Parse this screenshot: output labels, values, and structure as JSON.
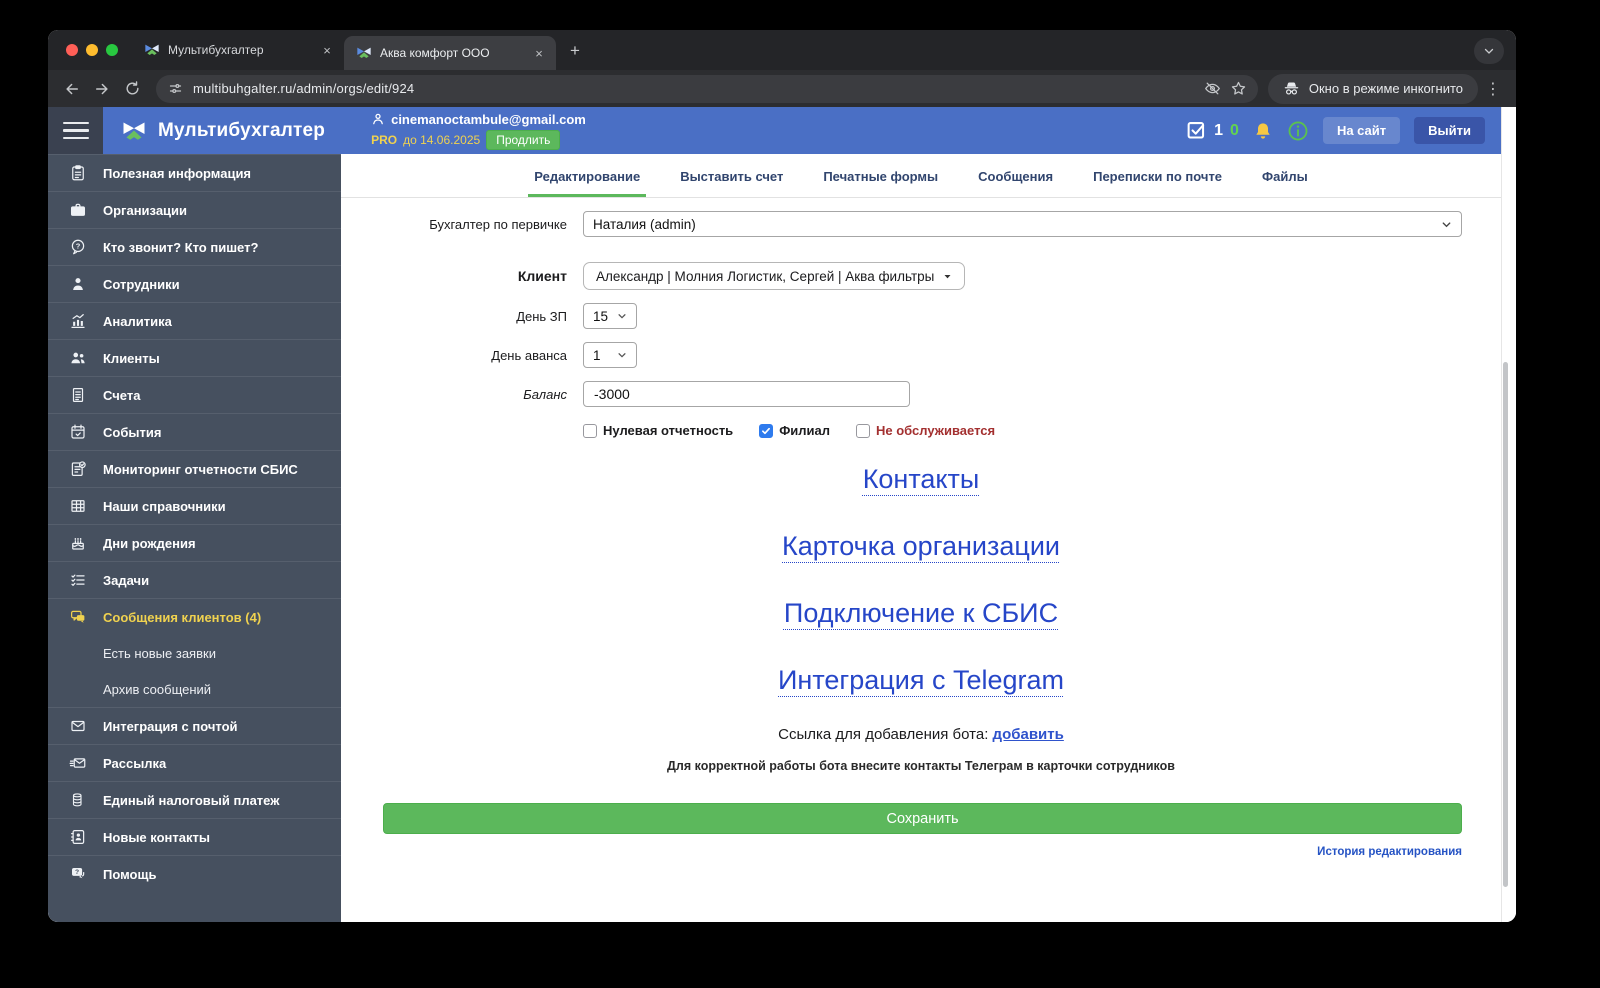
{
  "colors": {
    "header-blue": "#4a6fc5",
    "sidebar-dark": "#46505f",
    "sidebar-darker": "#3a4150",
    "accent-green": "#5cb85c",
    "accent-yellow": "#f0d24f",
    "link-blue": "#2646c8",
    "tab-navy": "#31456e",
    "danger-red": "#a33030",
    "checkbox-blue": "#2e7bee"
  },
  "browser": {
    "tab1_title": "Мультибухгалтер",
    "tab2_title": "Аква комфорт ООО",
    "url": "multibuhgalter.ru/admin/orgs/edit/924",
    "incognito_label": "Окно в режиме инкогнито"
  },
  "header": {
    "brand": "Мультибухгалтер",
    "email": "cinemanoctambule@gmail.com",
    "plan_badge": "PRO",
    "plan_until": "до 14.06.2025",
    "renew_button": "Продлить",
    "counter_primary": "1",
    "counter_secondary": "0",
    "site_button": "На сайт",
    "logout_button": "Выйти"
  },
  "sidebar": {
    "items": [
      {
        "label": "Полезная информация",
        "icon": "clipboard-icon"
      },
      {
        "label": "Организации",
        "icon": "briefcase-icon"
      },
      {
        "label": "Кто звонит? Кто пишет?",
        "icon": "question-bubble-icon"
      },
      {
        "label": "Сотрудники",
        "icon": "person-icon"
      },
      {
        "label": "Аналитика",
        "icon": "analytics-icon"
      },
      {
        "label": "Клиенты",
        "icon": "people-icon"
      },
      {
        "label": "Счета",
        "icon": "invoice-icon"
      },
      {
        "label": "События",
        "icon": "calendar-check-icon"
      },
      {
        "label": "Мониторинг отчетности СБИС",
        "icon": "report-check-icon"
      },
      {
        "label": "Наши справочники",
        "icon": "table-icon"
      },
      {
        "label": "Дни рождения",
        "icon": "cake-icon"
      },
      {
        "label": "Задачи",
        "icon": "task-list-icon"
      },
      {
        "label": "Сообщения клиентов (4)",
        "icon": "chat-icon",
        "highlighted": true
      },
      {
        "label": "Есть новые заявки",
        "sub": true
      },
      {
        "label": "Архив сообщений",
        "sub": true
      },
      {
        "label": "Интеграция с почтой",
        "icon": "mail-icon"
      },
      {
        "label": "Рассылка",
        "icon": "mail-send-icon"
      },
      {
        "label": "Единый налоговый платеж",
        "icon": "coins-icon"
      },
      {
        "label": "Новые контакты",
        "icon": "address-book-icon"
      },
      {
        "label": "Помощь",
        "icon": "help-chat-icon"
      }
    ]
  },
  "main": {
    "tabs": [
      "Редактирование",
      "Выставить счет",
      "Печатные формы",
      "Сообщения",
      "Переписки по почте",
      "Файлы"
    ],
    "form": {
      "accountant_label": "Бухгалтер по первичке",
      "accountant_value": "Наталия (admin)",
      "client_label": "Клиент",
      "client_value": "Александр | Молния Логистик, Сергей | Аква фильтры",
      "salary_day_label": "День ЗП",
      "salary_day_value": "15",
      "advance_day_label": "День аванса",
      "advance_day_value": "1",
      "balance_label": "Баланс",
      "balance_value": "-3000",
      "checkboxes": [
        {
          "label": "Нулевая отчетность",
          "checked": false
        },
        {
          "label": "Филиал",
          "checked": true
        },
        {
          "label": "Не обслуживается",
          "checked": false,
          "danger": true
        }
      ]
    },
    "links": [
      "Контакты",
      "Карточка организации",
      "Подключение к СБИС",
      "Интеграция с Telegram"
    ],
    "bot": {
      "label": "Ссылка для добавления бота:",
      "link": "добавить",
      "note": "Для корректной работы бота внесите контакты Телеграм в карточки сотрудников"
    },
    "save_button": "Сохранить",
    "history_link": "История редактирования"
  }
}
